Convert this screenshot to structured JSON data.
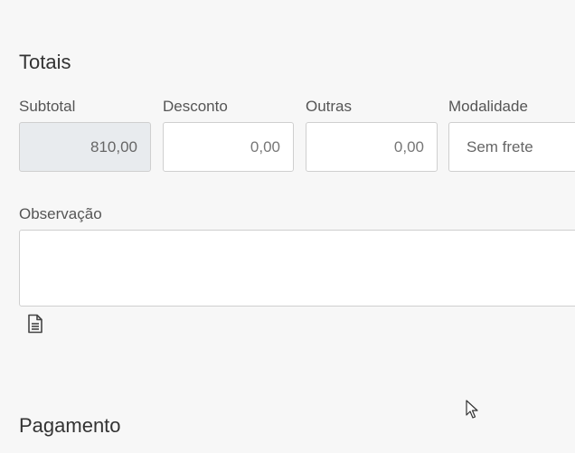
{
  "totals_section": {
    "title": "Totais",
    "subtotal": {
      "label": "Subtotal",
      "value": "810,00"
    },
    "desconto": {
      "label": "Desconto",
      "value": "0,00"
    },
    "outras": {
      "label": "Outras",
      "value": "0,00"
    },
    "modalidade": {
      "label": "Modalidade",
      "value": "Sem frete"
    },
    "observacao": {
      "label": "Observação",
      "value": ""
    }
  },
  "payment_section": {
    "title": "Pagamento"
  },
  "icons": {
    "notes": "document-icon",
    "pointer": "mouse-cursor-icon"
  }
}
